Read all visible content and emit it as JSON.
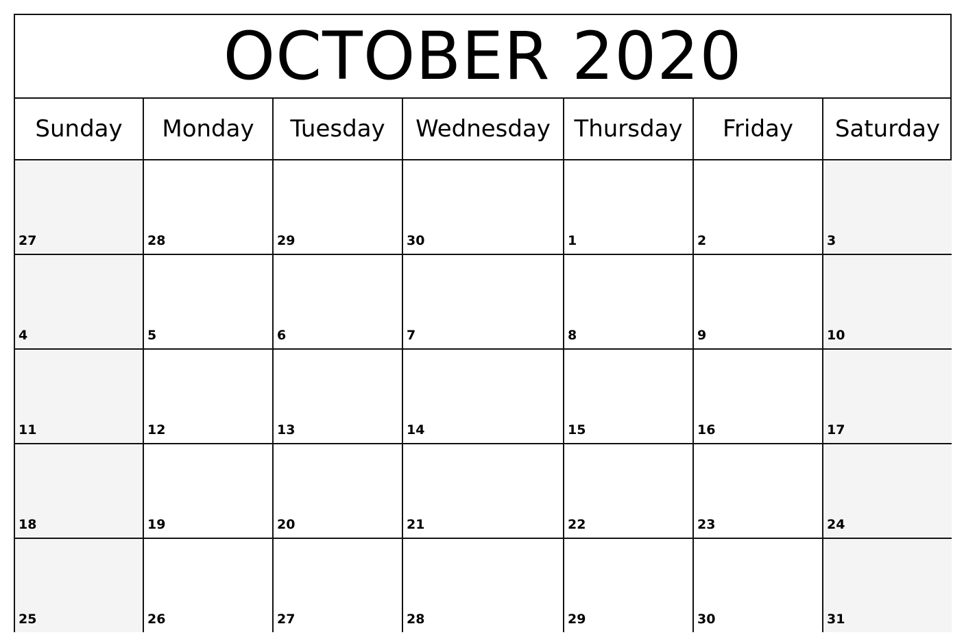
{
  "calendar": {
    "title": "OCTOBER 2020",
    "weekdays": [
      "Sunday",
      "Monday",
      "Tuesday",
      "Wednesday",
      "Thursday",
      "Friday",
      "Saturday"
    ],
    "weeks": [
      [
        "27",
        "28",
        "29",
        "30",
        "1",
        "2",
        "3"
      ],
      [
        "4",
        "5",
        "6",
        "7",
        "8",
        "9",
        "10"
      ],
      [
        "11",
        "12",
        "13",
        "14",
        "15",
        "16",
        "17"
      ],
      [
        "18",
        "19",
        "20",
        "21",
        "22",
        "23",
        "24"
      ],
      [
        "25",
        "26",
        "27",
        "28",
        "29",
        "30",
        "31"
      ]
    ],
    "colors": {
      "weekend_fill": "#f4f4f4",
      "weekday_fill": "#ffffff",
      "grid_line": "#111111",
      "text": "#000000"
    }
  }
}
